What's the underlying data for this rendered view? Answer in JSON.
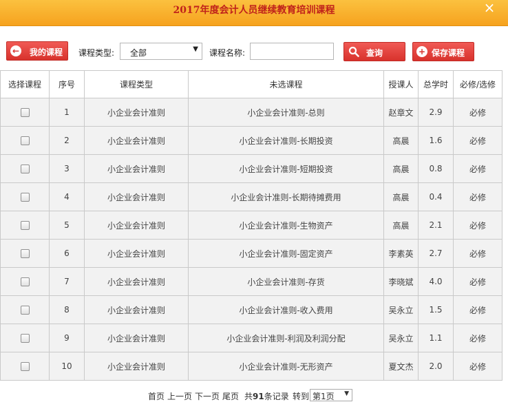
{
  "window": {
    "title": "2017年度会计人员继续教育培训课程",
    "close_glyph": "×"
  },
  "toolbar": {
    "my_course_label": "我的课程",
    "course_type_label": "课程类型:",
    "course_type_value": "全部",
    "course_name_label": "课程名称:",
    "course_name_value": "",
    "search_label": "查询",
    "save_label": "保存课程"
  },
  "icons": {
    "my_course": "arrow-left-icon",
    "search": "search-icon",
    "save": "plus-icon",
    "close": "close-icon"
  },
  "colors": {
    "accent_red": "#d8322c",
    "title_bar": "#f6a21e",
    "header_type": "#1f1fd0",
    "header_course": "#e02626"
  },
  "table": {
    "headers": [
      "选择课程",
      "序号",
      "课程类型",
      "未选课程",
      "授课人",
      "总学时",
      "必修/选修"
    ],
    "rows": [
      {
        "no": "1",
        "type": "小企业会计准则",
        "course": "小企业会计准则-总则",
        "teacher": "赵章文",
        "hours": "2.9",
        "req": "必修"
      },
      {
        "no": "2",
        "type": "小企业会计准则",
        "course": "小企业会计准则-长期投资",
        "teacher": "高晨",
        "hours": "1.6",
        "req": "必修"
      },
      {
        "no": "3",
        "type": "小企业会计准则",
        "course": "小企业会计准则-短期投资",
        "teacher": "高晨",
        "hours": "0.8",
        "req": "必修"
      },
      {
        "no": "4",
        "type": "小企业会计准则",
        "course": "小企业会计准则-长期待摊费用",
        "teacher": "高晨",
        "hours": "0.4",
        "req": "必修"
      },
      {
        "no": "5",
        "type": "小企业会计准则",
        "course": "小企业会计准则-生物资产",
        "teacher": "高晨",
        "hours": "2.1",
        "req": "必修"
      },
      {
        "no": "6",
        "type": "小企业会计准则",
        "course": "小企业会计准则-固定资产",
        "teacher": "李素英",
        "hours": "2.7",
        "req": "必修"
      },
      {
        "no": "7",
        "type": "小企业会计准则",
        "course": "小企业会计准则-存货",
        "teacher": "李晓斌",
        "hours": "4.0",
        "req": "必修"
      },
      {
        "no": "8",
        "type": "小企业会计准则",
        "course": "小企业会计准则-收入费用",
        "teacher": "吴永立",
        "hours": "1.5",
        "req": "必修"
      },
      {
        "no": "9",
        "type": "小企业会计准则",
        "course": "小企业会计准则-利润及利润分配",
        "teacher": "吴永立",
        "hours": "1.1",
        "req": "必修"
      },
      {
        "no": "10",
        "type": "小企业会计准则",
        "course": "小企业会计准则-无形资产",
        "teacher": "夏文杰",
        "hours": "2.0",
        "req": "必修"
      }
    ]
  },
  "pager": {
    "first": "首页",
    "prev": "上一页",
    "next": "下一页",
    "last": "尾页",
    "total_prefix": "共",
    "total_count": "91",
    "total_suffix": "条记录",
    "goto_label": "转到",
    "goto_value": "第1页"
  }
}
